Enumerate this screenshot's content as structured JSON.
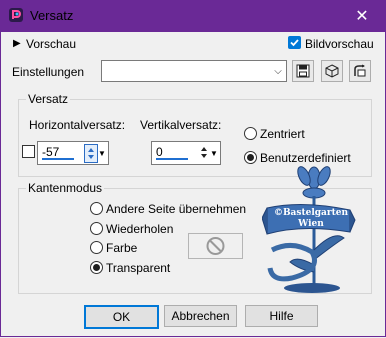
{
  "window": {
    "title": "Versatz",
    "close_glyph": "✕"
  },
  "header": {
    "preview_label": "Vorschau",
    "preview_toggle_glyph": "▶",
    "bildvorschau_label": "Bildvorschau",
    "bildvorschau_checked": true
  },
  "settings": {
    "label": "Einstellungen",
    "value": "",
    "dropdown_glyph": "⌵"
  },
  "versatz": {
    "legend": "Versatz",
    "horizontal_label": "Horizontalversatz:",
    "horizontal_value": "-57",
    "vertical_label": "Vertikalversatz:",
    "vertical_value": "0",
    "zentriert_label": "Zentriert",
    "benutzer_label": "Benutzerdefiniert",
    "selected": "Benutzerdefiniert",
    "link_checked": false
  },
  "kanten": {
    "legend": "Kantenmodus",
    "options": [
      "Andere Seite übernehmen",
      "Wiederholen",
      "Farbe",
      "Transparent"
    ],
    "selected": "Transparent",
    "color_swatch_disabled_glyph": "⃠"
  },
  "watermark": {
    "text": "©Bastelgarten Wien",
    "line1": "©Bastelgarten",
    "line2": "Wien"
  },
  "buttons": {
    "ok": "OK",
    "cancel": "Abbrechen",
    "help": "Hilfe"
  },
  "colors": {
    "titlebar": "#6a2996",
    "accent": "#0078d7",
    "watermark": "#3a6aa5"
  }
}
